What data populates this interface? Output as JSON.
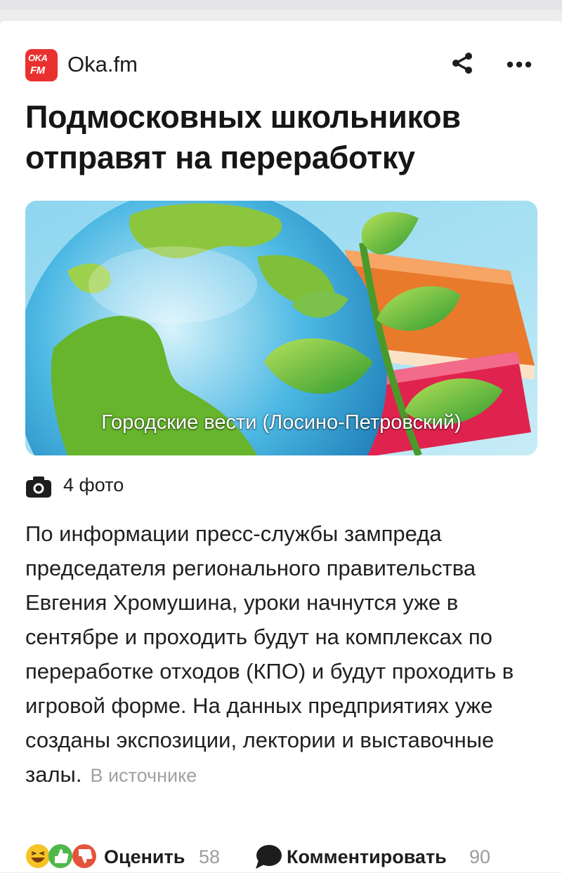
{
  "source": {
    "logo_line1": "OKA",
    "logo_line2": "FM",
    "name": "Oka.fm"
  },
  "article": {
    "title": "Подмосковных школьников отправят на переработку",
    "image_caption": "Городские вести (Лосино-Петровский)",
    "photos_label": "4 фото",
    "body": "По информации пресс-службы зампреда председателя регионального правительства Евгения Хромушина, уроки начнутся уже в сентябре и проходить будут на комплексах по переработке отходов (КПО) и будут проходить в игровой форме. На данных предприятиях уже созданы экспозиции, лектории и выставочные залы.",
    "source_link": "В источнике"
  },
  "footer": {
    "rate_label": "Оценить",
    "rate_count": "58",
    "comment_label": "Комментировать",
    "comment_count": "90"
  },
  "icons": {
    "share": "share-icon",
    "more": "more-dots-icon",
    "camera": "camera-icon",
    "comment": "speech-bubble-icon",
    "reactions": [
      "laughing-emoji-icon",
      "thumbs-up-icon",
      "thumbs-down-icon"
    ]
  },
  "colors": {
    "brand": "#e8312f",
    "muted_text": "#9b9ba0",
    "background": "#ffffff"
  }
}
